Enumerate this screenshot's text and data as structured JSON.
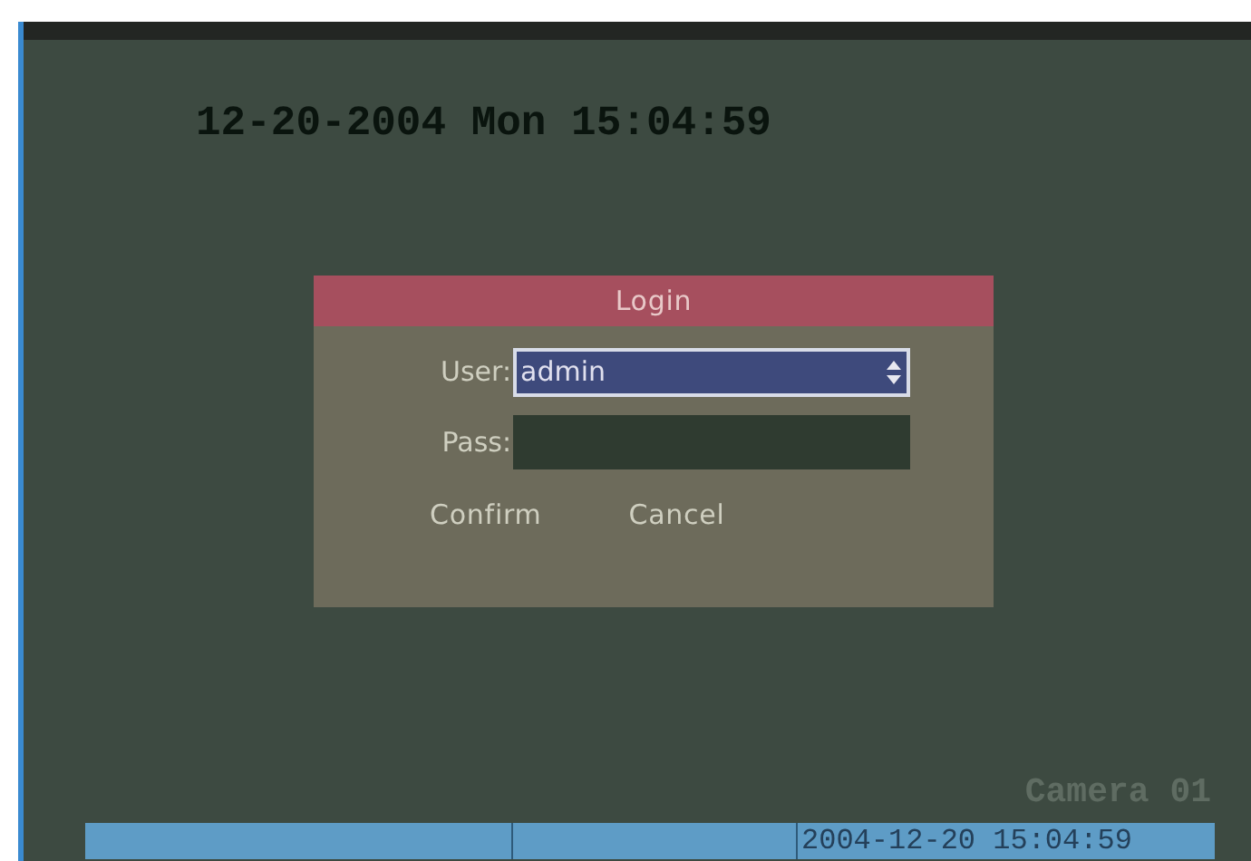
{
  "clock": "12-20-2004 Mon 15:04:59",
  "dialog": {
    "title": "Login",
    "fields": [
      {
        "label": "User:",
        "kind": "select",
        "value": "admin",
        "selected": true
      },
      {
        "label": "Pass:",
        "kind": "password",
        "selected": false
      }
    ],
    "buttons": [
      "Confirm",
      "Cancel"
    ]
  },
  "camera_label": "Camera 01",
  "status_bar": {
    "datetime": "2004-12-20 15:04:59"
  }
}
